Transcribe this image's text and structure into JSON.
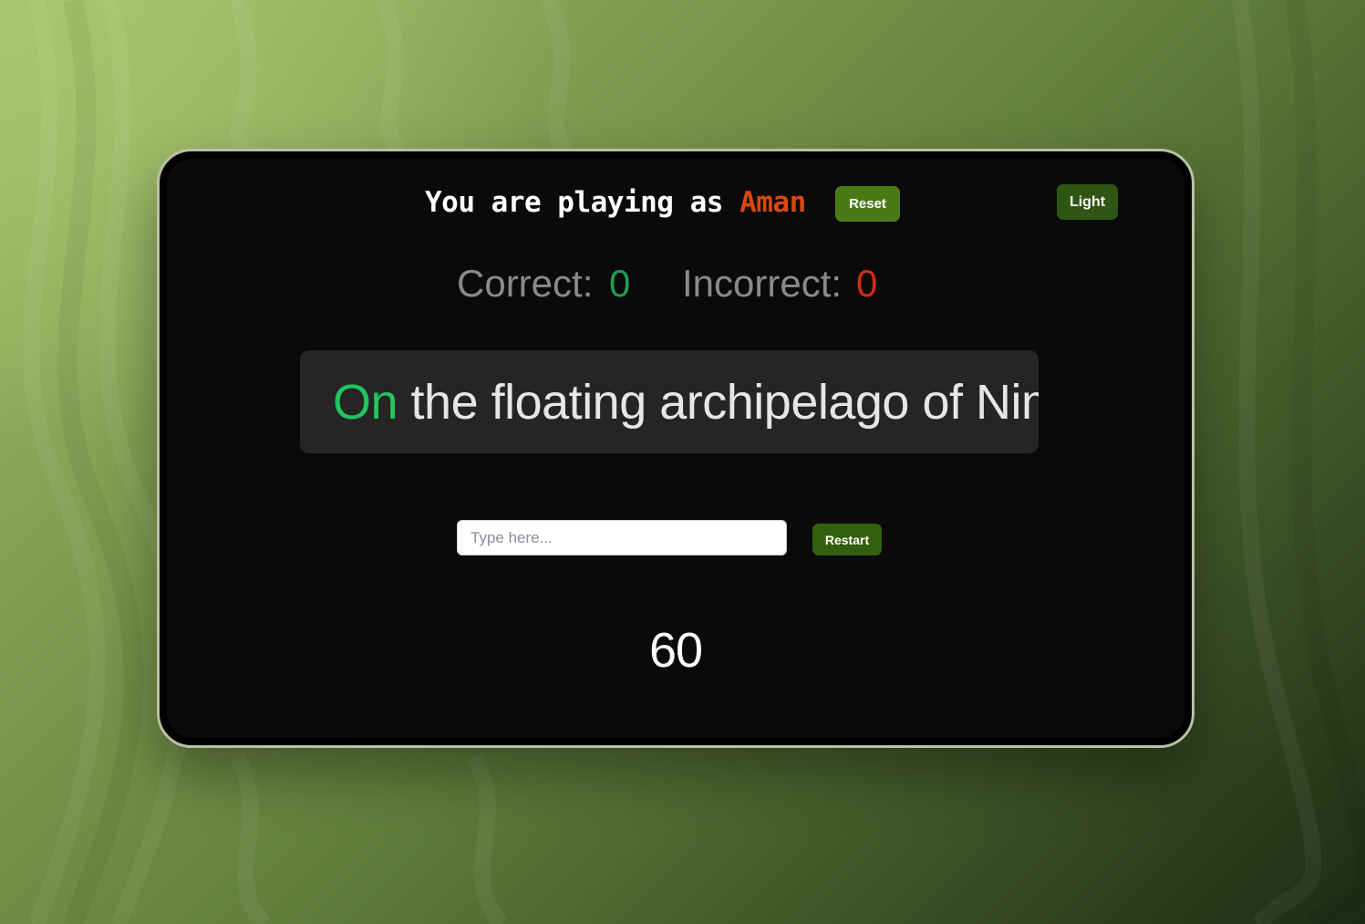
{
  "header": {
    "title_prefix": "You are playing as ",
    "player_name": "Aman",
    "reset_label": "Reset",
    "theme_toggle_label": "Light"
  },
  "scores": {
    "correct_label": "Correct:",
    "correct_value": "0",
    "incorrect_label": "Incorrect:",
    "incorrect_value": "0"
  },
  "passage": {
    "current_word": "On",
    "remaining_text": " the floating archipelago of Nimb"
  },
  "input": {
    "value": "",
    "placeholder": "Type here..."
  },
  "controls": {
    "restart_label": "Restart"
  },
  "timer": {
    "seconds_left": "60"
  },
  "colors": {
    "accent_button": "#3d6b12",
    "player_name": "#d9480f",
    "correct": "#1f9d55",
    "incorrect": "#d42a1c",
    "current_word": "#22c55e"
  }
}
